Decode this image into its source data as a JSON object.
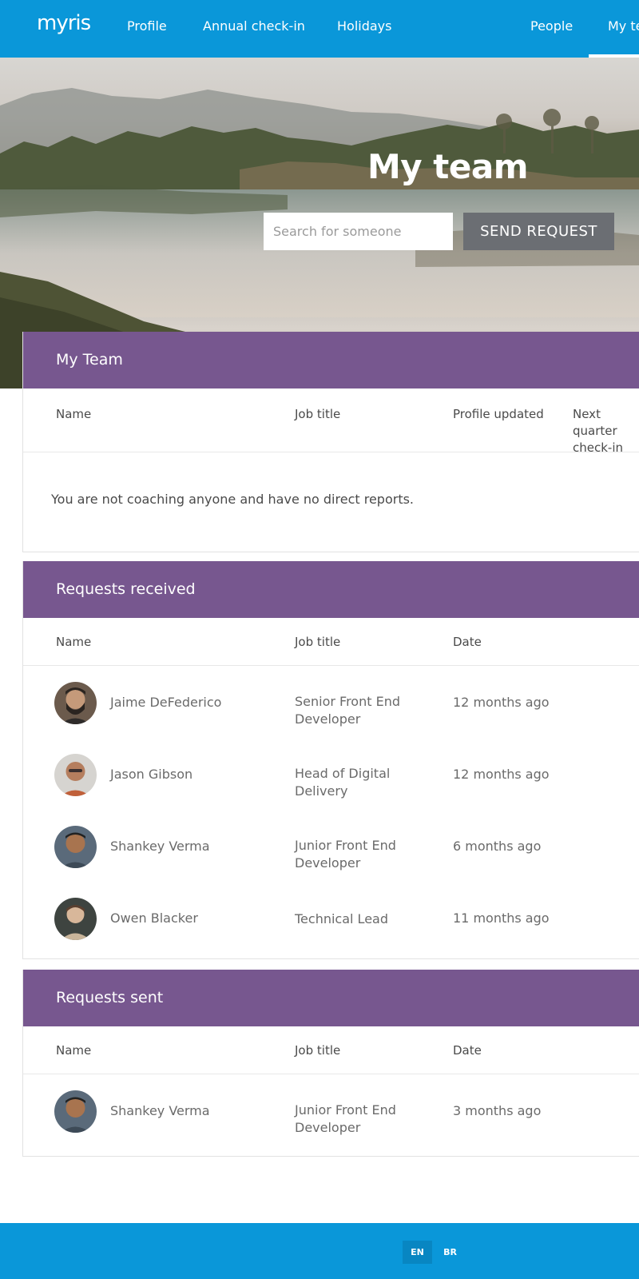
{
  "brand": {
    "logo_text": "myris"
  },
  "nav": {
    "items": [
      {
        "label": "Profile"
      },
      {
        "label": "Annual check-in"
      },
      {
        "label": "Holidays"
      },
      {
        "label": "People"
      },
      {
        "label": "My te"
      }
    ],
    "active": "My te"
  },
  "hero": {
    "title": "My team",
    "search_placeholder": "Search for someone",
    "send_button": "SEND REQUEST"
  },
  "my_team": {
    "title": "My Team",
    "columns": [
      "Name",
      "Job title",
      "Profile updated",
      "Next quarter\ncheck-in"
    ],
    "empty_message": "You are not coaching anyone and have no direct reports."
  },
  "requests_received": {
    "title": "Requests received",
    "columns": [
      "Name",
      "Job title",
      "Date"
    ],
    "rows": [
      {
        "name": "Jaime DeFederico",
        "job": "Senior Front End Developer",
        "date": "12 months ago"
      },
      {
        "name": "Jason Gibson",
        "job": "Head of Digital Delivery",
        "date": "12 months ago"
      },
      {
        "name": "Shankey Verma",
        "job": "Junior Front End Developer",
        "date": "6 months ago"
      },
      {
        "name": "Owen Blacker",
        "job": "Technical Lead",
        "date": "11 months ago"
      }
    ]
  },
  "requests_sent": {
    "title": "Requests sent",
    "columns": [
      "Name",
      "Job title",
      "Date"
    ],
    "rows": [
      {
        "name": "Shankey Verma",
        "job": "Junior Front End Developer",
        "date": "3 months ago"
      }
    ]
  },
  "footer": {
    "languages": [
      "EN",
      "BR"
    ],
    "active_language": "EN"
  },
  "colors": {
    "nav_blue": "#0a97d9",
    "section_purple": "#77578f",
    "button_grey": "#6b6e73"
  }
}
